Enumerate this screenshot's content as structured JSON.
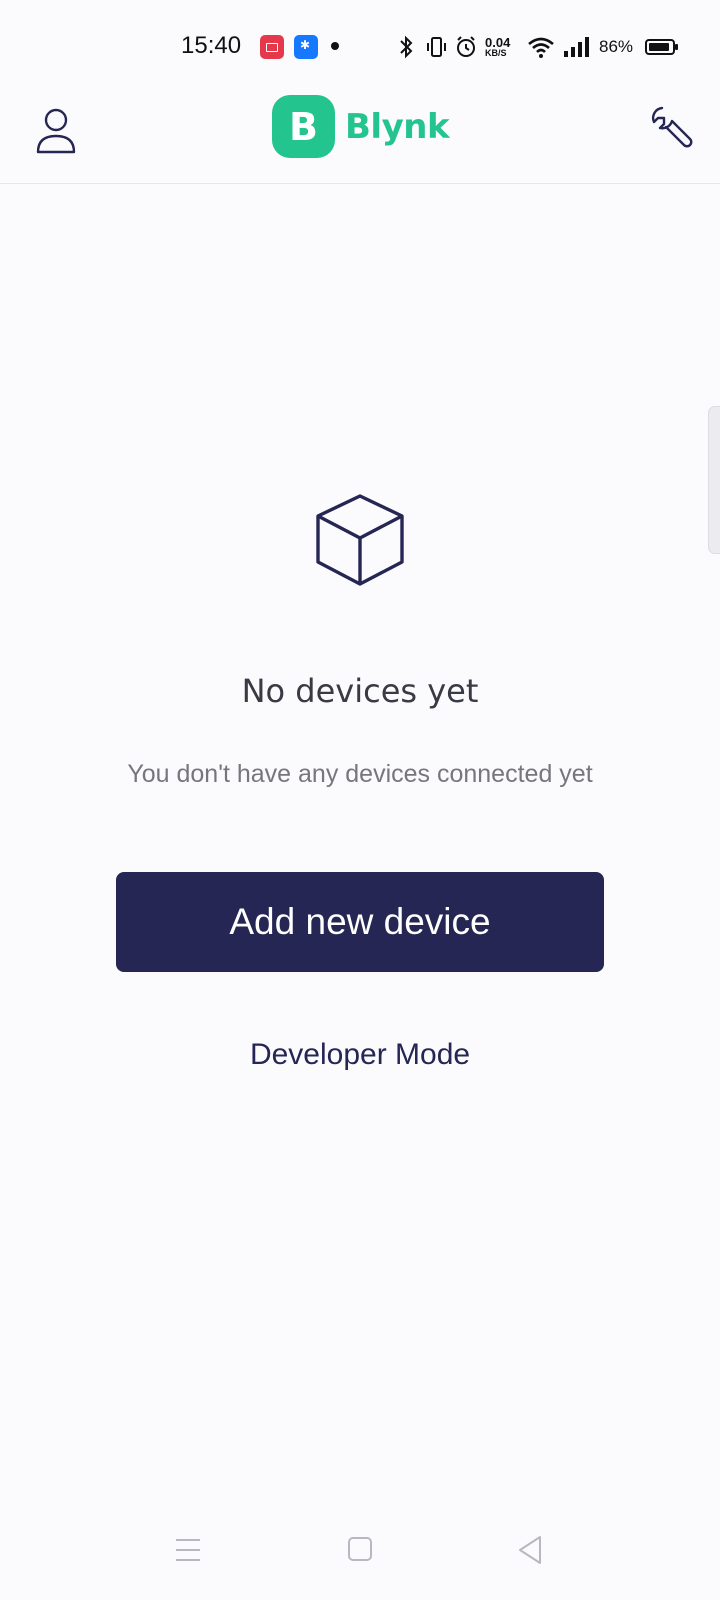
{
  "status_bar": {
    "time": "15:40",
    "net_speed_value": "0.04",
    "net_speed_unit": "KB/S",
    "battery_percent": "86%",
    "battery_level": 0.86,
    "icons": [
      "screen-record-app-icon",
      "bluetooth-app-icon",
      "notification-dot",
      "bluetooth-icon",
      "vibrate-icon",
      "alarm-icon",
      "wifi-icon",
      "signal-icon",
      "battery-icon"
    ]
  },
  "header": {
    "logo_letter": "B",
    "logo_text": "Blynk",
    "left_icon": "profile-icon",
    "right_icon": "wrench-icon"
  },
  "empty_state": {
    "icon": "cube-icon",
    "title": "No devices yet",
    "subtitle": "You don't have any devices connected yet",
    "primary_button": "Add new device",
    "secondary_link": "Developer Mode"
  },
  "nav_bar": {
    "buttons": [
      "menu-icon",
      "home-square-icon",
      "back-triangle-icon"
    ]
  },
  "colors": {
    "brand_green": "#23c48e",
    "primary_navy": "#262654",
    "background": "#fbfbfd"
  }
}
